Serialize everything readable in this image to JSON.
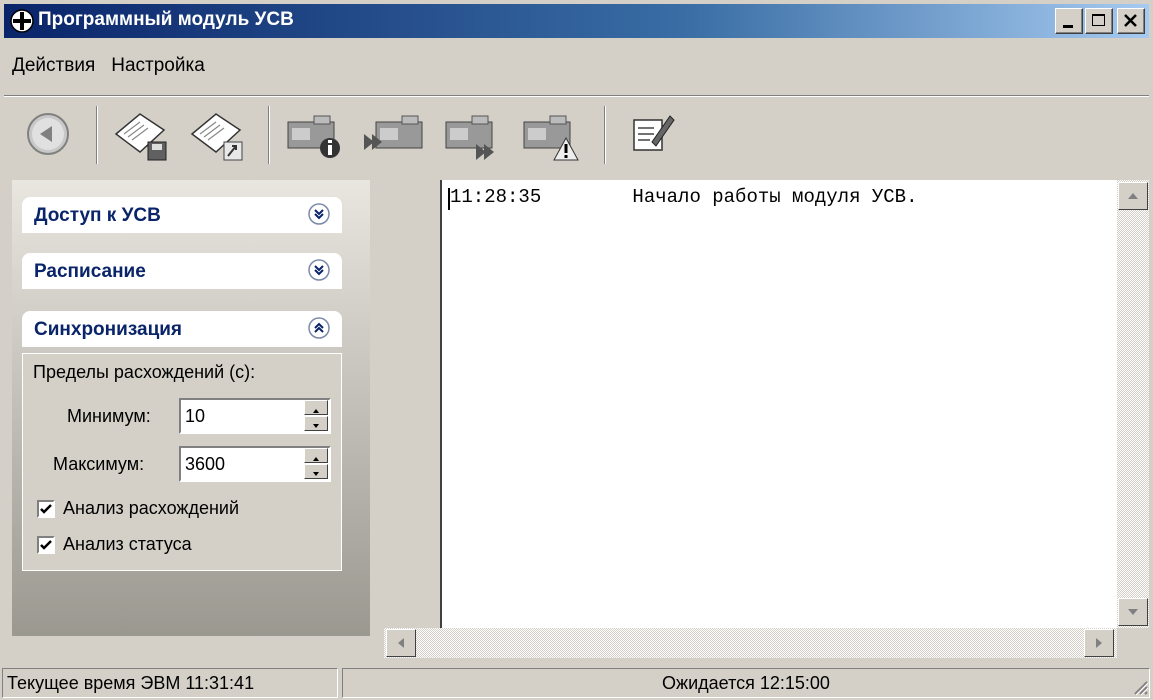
{
  "window": {
    "title": "Программный модуль УСВ"
  },
  "menu": {
    "items": [
      "Действия",
      "Настройка"
    ]
  },
  "panel": {
    "sections": [
      {
        "label": "Доступ к УСВ",
        "state": "collapsed"
      },
      {
        "label": "Расписание",
        "state": "collapsed"
      },
      {
        "label": "Синхронизация",
        "state": "expanded"
      }
    ],
    "sync": {
      "limits_label": "Пределы расхождений (с):",
      "min_label": "Минимум:",
      "min_value": "10",
      "max_label": "Максимум:",
      "max_value": "3600",
      "check1_label": "Анализ расхождений",
      "check1_checked": true,
      "check2_label": "Анализ статуса",
      "check2_checked": true
    }
  },
  "log": {
    "lines": [
      "11:28:35        Начало работы модуля УСВ."
    ]
  },
  "status": {
    "left": "Текущее время ЭВМ 11:31:41",
    "center": "Ожидается 12:15:00"
  },
  "icons": [
    "back-icon",
    "save-document-icon",
    "export-document-icon",
    "device-info-icon",
    "device-receive-icon",
    "device-send-icon",
    "device-warning-icon",
    "edit-notes-icon"
  ],
  "colors": {
    "titlebar": "#0a246a",
    "panel_header_text": "#0a246a",
    "face": "#d4d0c8"
  }
}
